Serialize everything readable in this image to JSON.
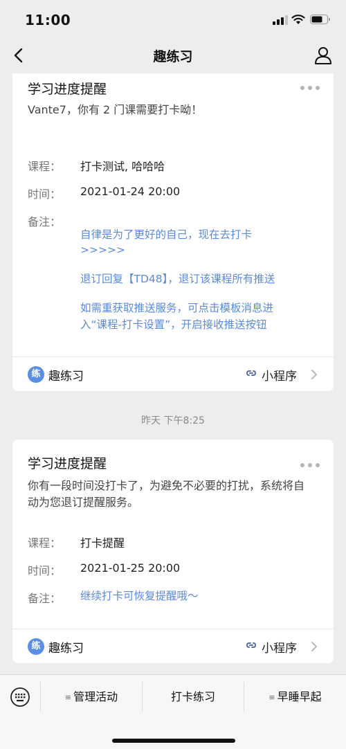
{
  "status_bar": {
    "time": "11:00"
  },
  "nav": {
    "title": "趣练习"
  },
  "cards": [
    {
      "title": "学习进度提醒",
      "intro": "Vante7，你有 2 门课需要打卡呦！",
      "course_label": "课程：",
      "course_value": "打卡测试, 哈哈哈",
      "time_label": "时间：",
      "time_value": "2021-01-24 20:00",
      "remark_label": "备注：",
      "remark_lines": [
        "自律是为了更好的自己，现在去打卡",
        ">>>>>",
        "退订回复【TD48】，退订该课程所有推送",
        "如需重获取推送服务，可点击模板消息进",
        "入“课程-打卡设置”，开启接收推送按钮"
      ],
      "app_badge": "练",
      "app_name": "趣练习",
      "mini_program": "小程序"
    },
    {
      "title": "学习进度提醒",
      "intro": "你有一段时间没打卡了，为避免不必要的打扰，系统将自动为您退订提醒服务。",
      "course_label": "课程：",
      "course_value": "打卡提醒",
      "time_label": "时间：",
      "time_value": "2021-01-25 20:00",
      "remark_label": "备注：",
      "remark": "继续打卡可恢复提醒哦～",
      "app_badge": "练",
      "app_name": "趣练习",
      "mini_program": "小程序"
    }
  ],
  "timestamp": "昨天 下午8:25",
  "bottom_menu": {
    "items": [
      {
        "label": "管理活动",
        "has_submenu": true
      },
      {
        "label": "打卡练习",
        "has_submenu": false
      },
      {
        "label": "早睡早起",
        "has_submenu": true
      }
    ]
  },
  "colors": {
    "link": "#5b8ad8",
    "badge": "#5a8fe3",
    "background": "#ededed"
  }
}
